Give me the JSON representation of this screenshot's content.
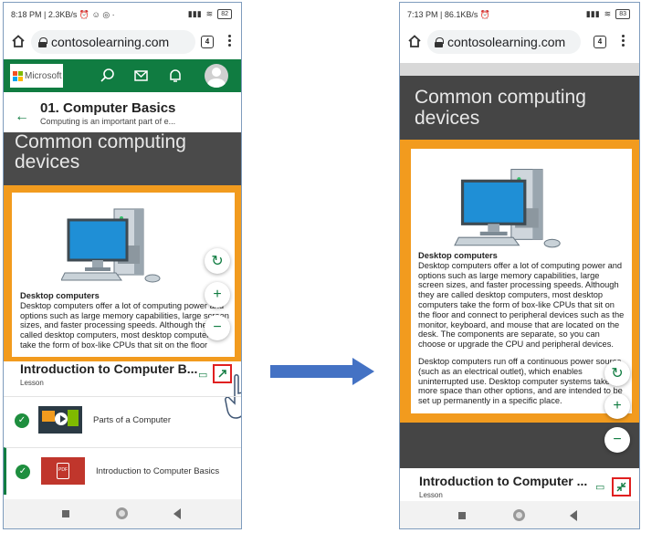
{
  "left": {
    "status": {
      "time": "8:18 PM",
      "speed": "2.3KB/s",
      "battery": "82"
    },
    "url": "contosolearning.com",
    "tab_count": "4",
    "brand": "Microsoft",
    "course": {
      "title": "01. Computer Basics",
      "subtitle": "Computing is an important part of e..."
    },
    "slide": {
      "title": "Common computing devices"
    },
    "card": {
      "heading": "Desktop computers",
      "body": "Desktop computers offer a lot of computing power and options such as large memory capabilities, large screen sizes, and faster processing speeds. Although they are called desktop computers, most desktop computers take the form of box-like CPUs that sit on the floor"
    },
    "lesson": {
      "title": "Introduction to Computer B...",
      "type": "Lesson"
    },
    "list": [
      {
        "label": "Parts of a Computer"
      },
      {
        "label": "Introduction to Computer Basics"
      }
    ]
  },
  "right": {
    "status": {
      "time": "7:13 PM",
      "speed": "86.1KB/s",
      "battery": "83"
    },
    "url": "contosolearning.com",
    "tab_count": "4",
    "slide": {
      "title": "Common computing devices"
    },
    "card": {
      "heading": "Desktop computers",
      "body1": "Desktop computers offer a lot of computing power and options such as large memory capabilities, large screen sizes, and faster processing speeds. Although they are called desktop computers, most desktop computers take the form of box-like CPUs that sit on the floor and connect to peripheral devices such as the monitor, keyboard, and mouse that are located on the desk. The components are separate, so you can choose or upgrade the CPU and peripheral devices.",
      "body2": "Desktop computers run off a continuous power source (such as an electrical outlet), which enables uninterrupted use. Desktop computer systems take up more space than other options, and are intended to be set up permanently in a specific place."
    },
    "lesson": {
      "title": "Introduction to Computer ...",
      "type": "Lesson"
    }
  },
  "colors": {
    "brand_green": "#107c41",
    "slide_dark": "#4a4a4a",
    "card_orange": "#f29b1e",
    "highlight_red": "#e02020",
    "arrow_blue": "#4472c4"
  }
}
